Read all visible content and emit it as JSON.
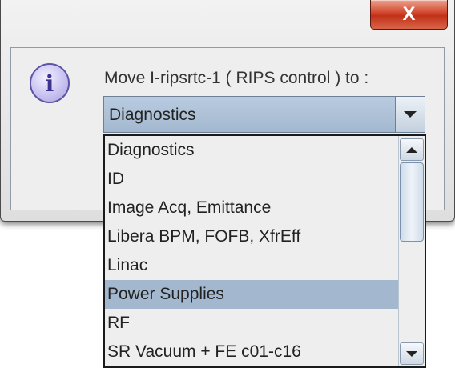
{
  "window": {
    "close_glyph": "X",
    "close_color": "#c0321a"
  },
  "dialog": {
    "icon_glyph": "i",
    "icon": "info-icon",
    "prompt": "Move I-ripsrtc-1  ( RIPS control )  to :"
  },
  "combo": {
    "selected": "Diagnostics",
    "arrow_icon": "chevron-down-icon"
  },
  "list": {
    "items": [
      "Diagnostics",
      "ID",
      "Image Acq, Emittance",
      "Libera BPM, FOFB, XfrEff",
      "Linac",
      "Power Supplies",
      "RF",
      "SR Vacuum + FE c01-c16"
    ],
    "highlighted": "Power Supplies",
    "highlight_color": "#a3b8cf"
  }
}
